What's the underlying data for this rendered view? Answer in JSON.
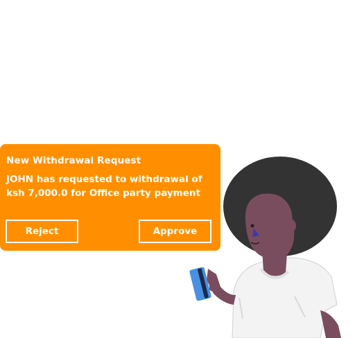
{
  "notification": {
    "title": "New Withdrawal Request",
    "message": "JOHN has requested to withdrawal of ksh 7,000.0 for Office party payment",
    "reject_label": "Reject",
    "approve_label": "Approve"
  },
  "colors": {
    "card_background": "#ff8f00",
    "card_text": "#ffffff",
    "skin": "#7a4d5e",
    "hair": "#333333",
    "shirt": "#f3f3f3",
    "phone": "#4a90e2"
  },
  "icons": {
    "person": "person-holding-phone-illustration",
    "phone": "smartphone-icon"
  }
}
